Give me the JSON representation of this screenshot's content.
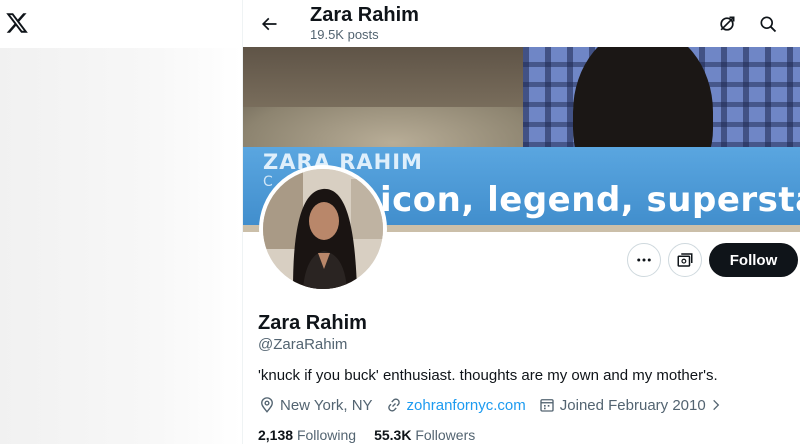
{
  "header": {
    "title": "Zara Rahim",
    "post_count": "19.5K posts"
  },
  "banner": {
    "lower_third_name": "ZARA RAHIM",
    "lower_third_sub": "C",
    "lower_third_quote": "icon, legend, superstar"
  },
  "actions": {
    "follow_label": "Follow"
  },
  "profile": {
    "name": "Zara Rahim",
    "handle": "@ZaraRahim",
    "bio": "'knuck if you buck' enthusiast. thoughts are my own and my mother's.",
    "location": "New York, NY",
    "website": "zohranfornyc.com",
    "joined": "Joined February 2010",
    "following_count": "2,138",
    "following_label": "Following",
    "followers_count": "55.3K",
    "followers_label": "Followers"
  },
  "colors": {
    "accent": "#1d9bf0",
    "text": "#0f1419",
    "muted": "#536471",
    "follow_bg": "#0f1419",
    "lower_third": "#4a97d4"
  },
  "icons": [
    "x-logo-icon",
    "back-arrow-icon",
    "grok-icon",
    "search-icon",
    "more-icon",
    "subscribe-icon",
    "location-icon",
    "link-icon",
    "calendar-icon",
    "chevron-right-icon"
  ]
}
